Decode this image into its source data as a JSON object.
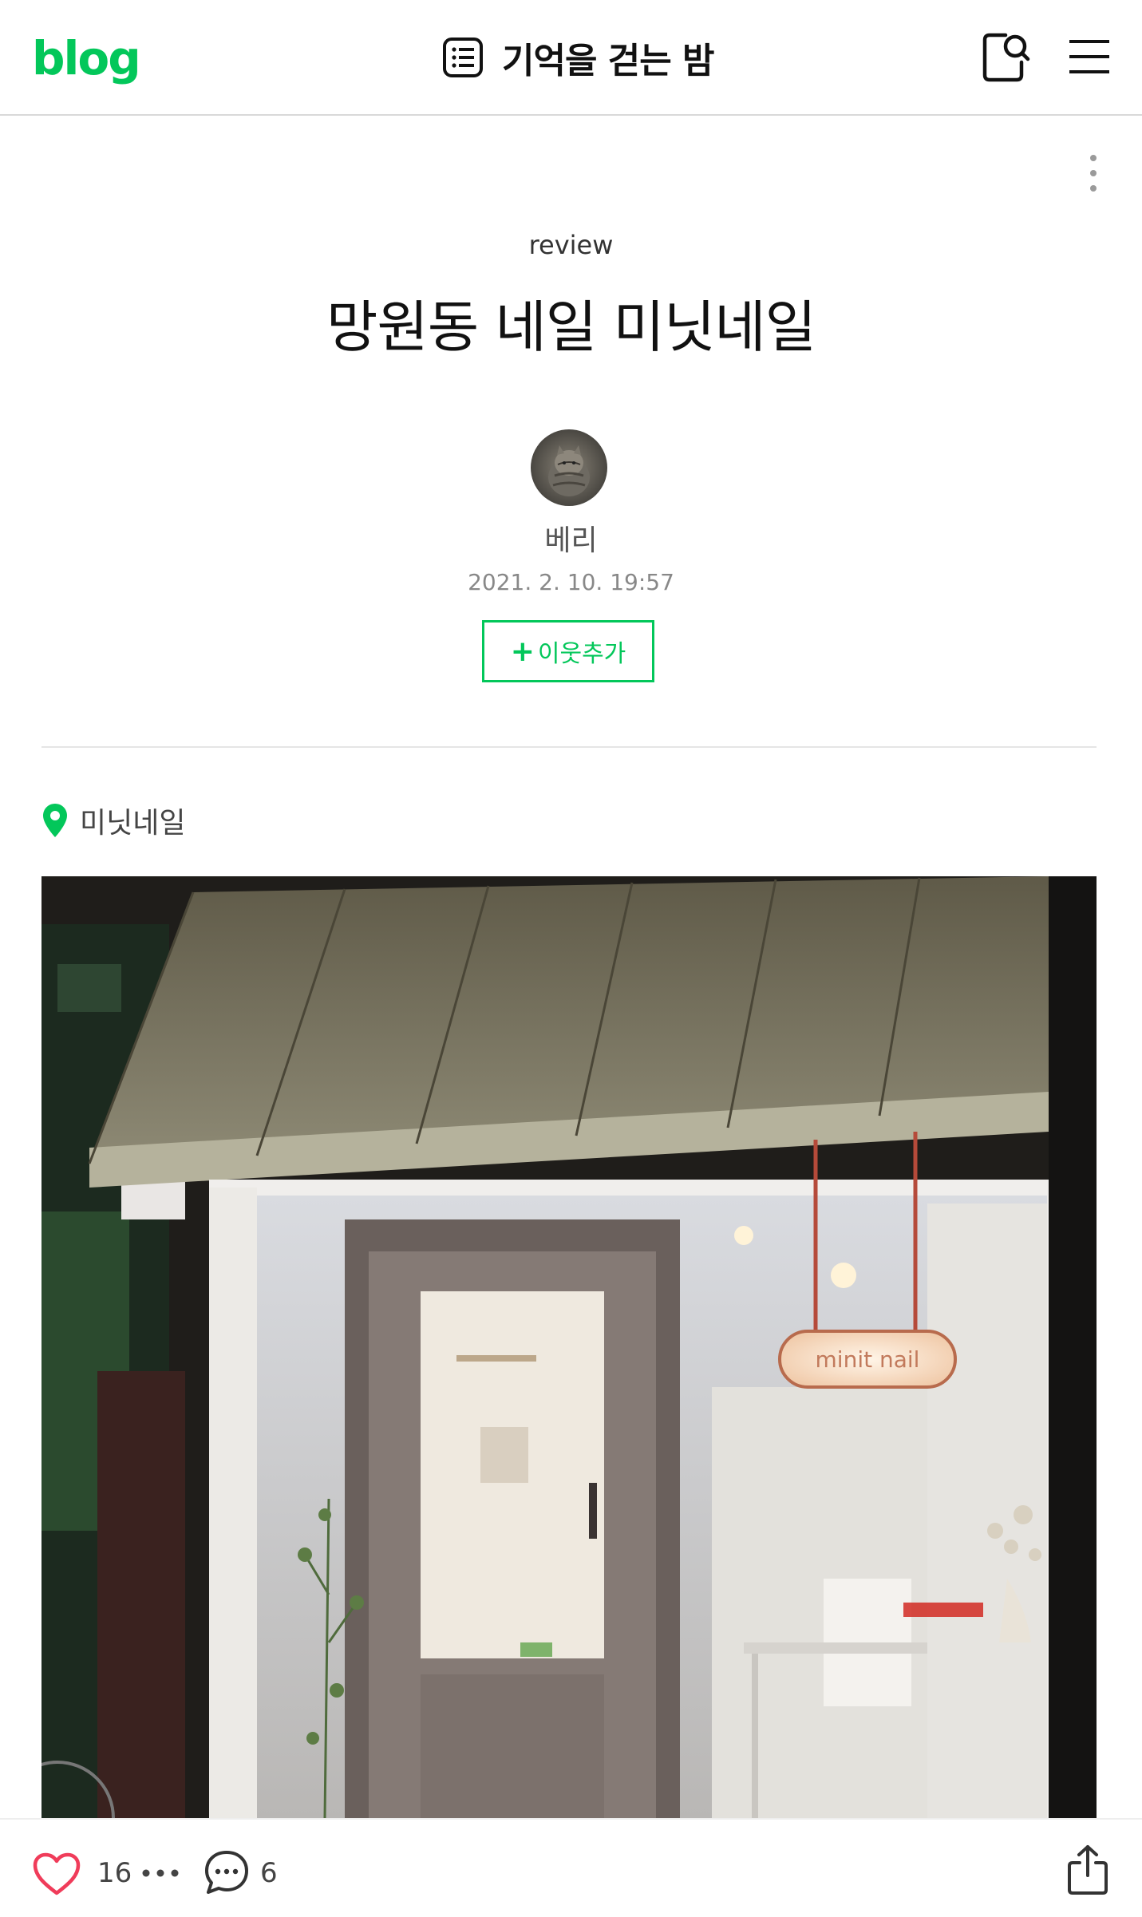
{
  "header": {
    "logo": "blog",
    "blog_title": "기억을 걷는 밤",
    "icons": {
      "list": "list-icon",
      "search": "search-icon",
      "menu": "hamburger-menu-icon"
    },
    "accent_color": "#03c75a"
  },
  "post": {
    "category": "review",
    "title": "망원동 네일 미닛네일",
    "author": "베리",
    "date": "2021. 2. 10. 19:57",
    "follow_button": {
      "plus": "+",
      "label": "이웃추가"
    },
    "place": {
      "label": "미닛네일",
      "icon": "location-pin-icon"
    },
    "photo": {
      "sign_text": "minit nail"
    }
  },
  "bottom_bar": {
    "like_count": "16",
    "comment_count": "6",
    "icons": {
      "like": "heart-icon",
      "more": "more-dots-icon",
      "comment": "comment-icon",
      "share": "share-icon"
    }
  }
}
